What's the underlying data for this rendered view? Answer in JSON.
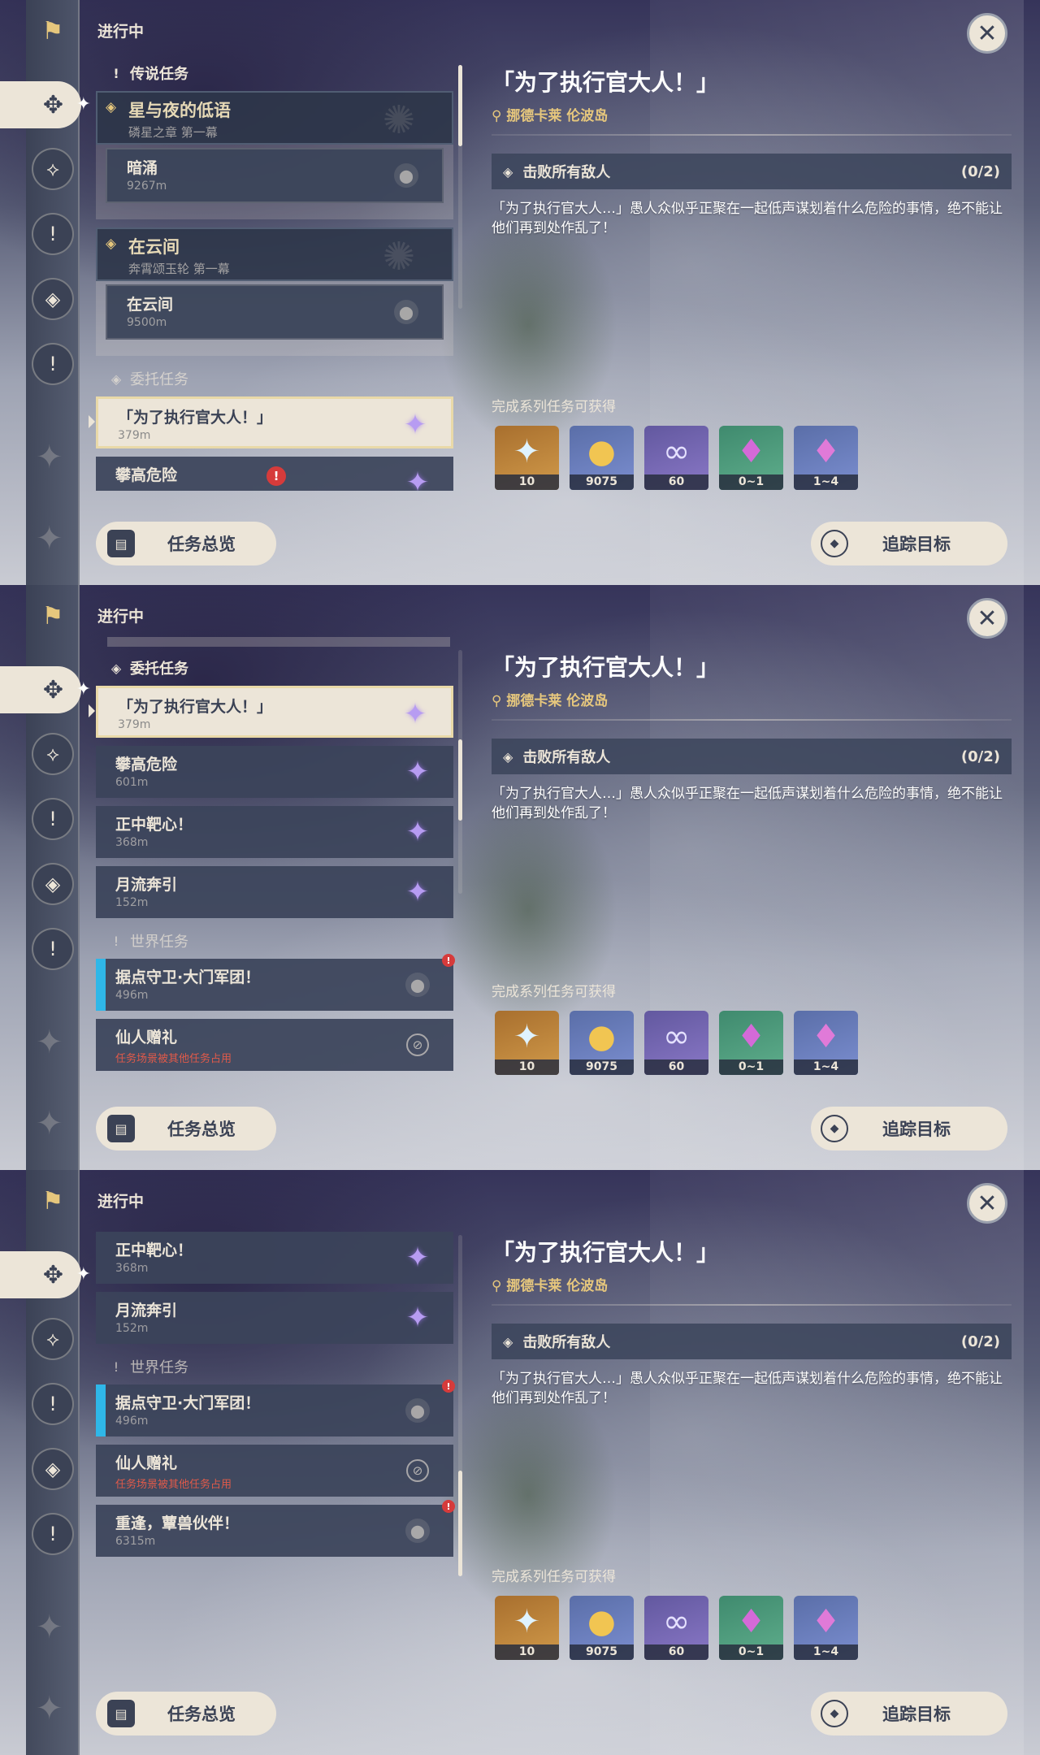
{
  "colors": {
    "accent_gold": "#e6c77d",
    "panel_dark": "#3b4255",
    "cream": "#ece5d8",
    "world_quest_blue": "#2fb7e8",
    "alert_red": "#d63b3b"
  },
  "status_label": "进行中",
  "icons": {
    "close": "close-icon",
    "rail": [
      "quest-flag-icon",
      "commission-icon",
      "archon-quest-icon",
      "legend-quest-icon",
      "world-quest-icon",
      "event-quest-icon"
    ]
  },
  "sections": {
    "legend": "传说任务",
    "commission": "委托任务",
    "world": "世界任务"
  },
  "chapters": [
    {
      "title": "星与夜的低语",
      "subtitle": "磷星之章 第一幕",
      "quest": {
        "title": "暗涌",
        "distance": "9267m"
      }
    },
    {
      "title": "在云间",
      "subtitle": "奔霄颂玉轮 第一幕",
      "quest": {
        "title": "在云间",
        "distance": "9500m"
      }
    }
  ],
  "commissions": [
    {
      "title": "「为了执行官大人！」",
      "distance": "379m"
    },
    {
      "title": "攀高危险",
      "distance": "601m"
    },
    {
      "title": "正中靶心！",
      "distance": "368m"
    },
    {
      "title": "月流奔引",
      "distance": "152m"
    }
  ],
  "world_quests": [
    {
      "title": "据点守卫·大门军团！",
      "distance": "496m",
      "new": "!"
    },
    {
      "title": "仙人赠礼",
      "note": "任务场景被其他任务占用"
    },
    {
      "title": "重逢，蕈兽伙伴！",
      "distance": "6315m",
      "new": "!"
    }
  ],
  "alert_mark": "!",
  "detail": {
    "title": "「为了执行官大人！」",
    "location": "挪德卡莱 伦波岛",
    "objective": "击败所有敌人",
    "progress": "(0/2)",
    "description": "「为了执行官大人…」愚人众似乎正聚在一起低声谋划着什么危险的事情，绝不能让他们再到处作乱了！",
    "rewards_label": "完成系列任务可获得",
    "rewards": [
      {
        "icon": "primogem-icon",
        "qty": "10"
      },
      {
        "icon": "mora-icon",
        "qty": "9075"
      },
      {
        "icon": "companionship-exp-icon",
        "qty": "60"
      },
      {
        "icon": "crystal-chunk-icon",
        "qty": "0~1"
      },
      {
        "icon": "crystal-cluster-icon",
        "qty": "1~4"
      }
    ]
  },
  "buttons": {
    "overview": "任务总览",
    "track": "追踪目标"
  }
}
